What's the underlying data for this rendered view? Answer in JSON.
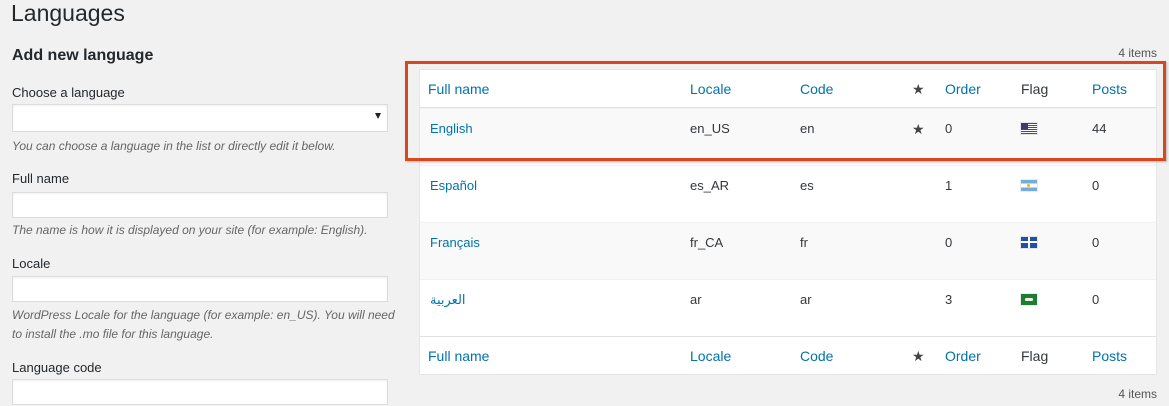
{
  "page": {
    "title": "Languages"
  },
  "form": {
    "title": "Add new language",
    "choose_language": {
      "label": "Choose a language",
      "value": "",
      "description": "You can choose a language in the list or directly edit it below."
    },
    "full_name": {
      "label": "Full name",
      "value": "",
      "description": "The name is how it is displayed on your site (for example: English)."
    },
    "locale": {
      "label": "Locale",
      "value": "",
      "description_line1": "WordPress Locale for the language (for example: en_US). You will need",
      "description_line2": "to install the .mo file for this language."
    },
    "language_code": {
      "label": "Language code",
      "value": ""
    }
  },
  "table": {
    "items_count_top": "4 items",
    "items_count_bottom": "4 items",
    "columns": {
      "full_name": "Full name",
      "locale": "Locale",
      "code": "Code",
      "default_icon": "star-icon",
      "order": "Order",
      "flag": "Flag",
      "posts": "Posts"
    },
    "rows": [
      {
        "full_name": "English",
        "locale": "en_US",
        "code": "en",
        "is_default": true,
        "order": "0",
        "flag": "us-flag-icon",
        "posts": "44"
      },
      {
        "full_name": "Español",
        "locale": "es_AR",
        "code": "es",
        "is_default": false,
        "order": "1",
        "flag": "argentina-flag-icon",
        "posts": "0"
      },
      {
        "full_name": "Français",
        "locale": "fr_CA",
        "code": "fr",
        "is_default": false,
        "order": "0",
        "flag": "quebec-flag-icon",
        "posts": "0"
      },
      {
        "full_name": "العربية",
        "locale": "ar",
        "code": "ar",
        "is_default": false,
        "order": "3",
        "flag": "saudi-flag-icon",
        "posts": "0"
      }
    ]
  },
  "colors": {
    "link": "#0073aa",
    "highlight": "#d9471f",
    "background": "#f1f1f1"
  }
}
